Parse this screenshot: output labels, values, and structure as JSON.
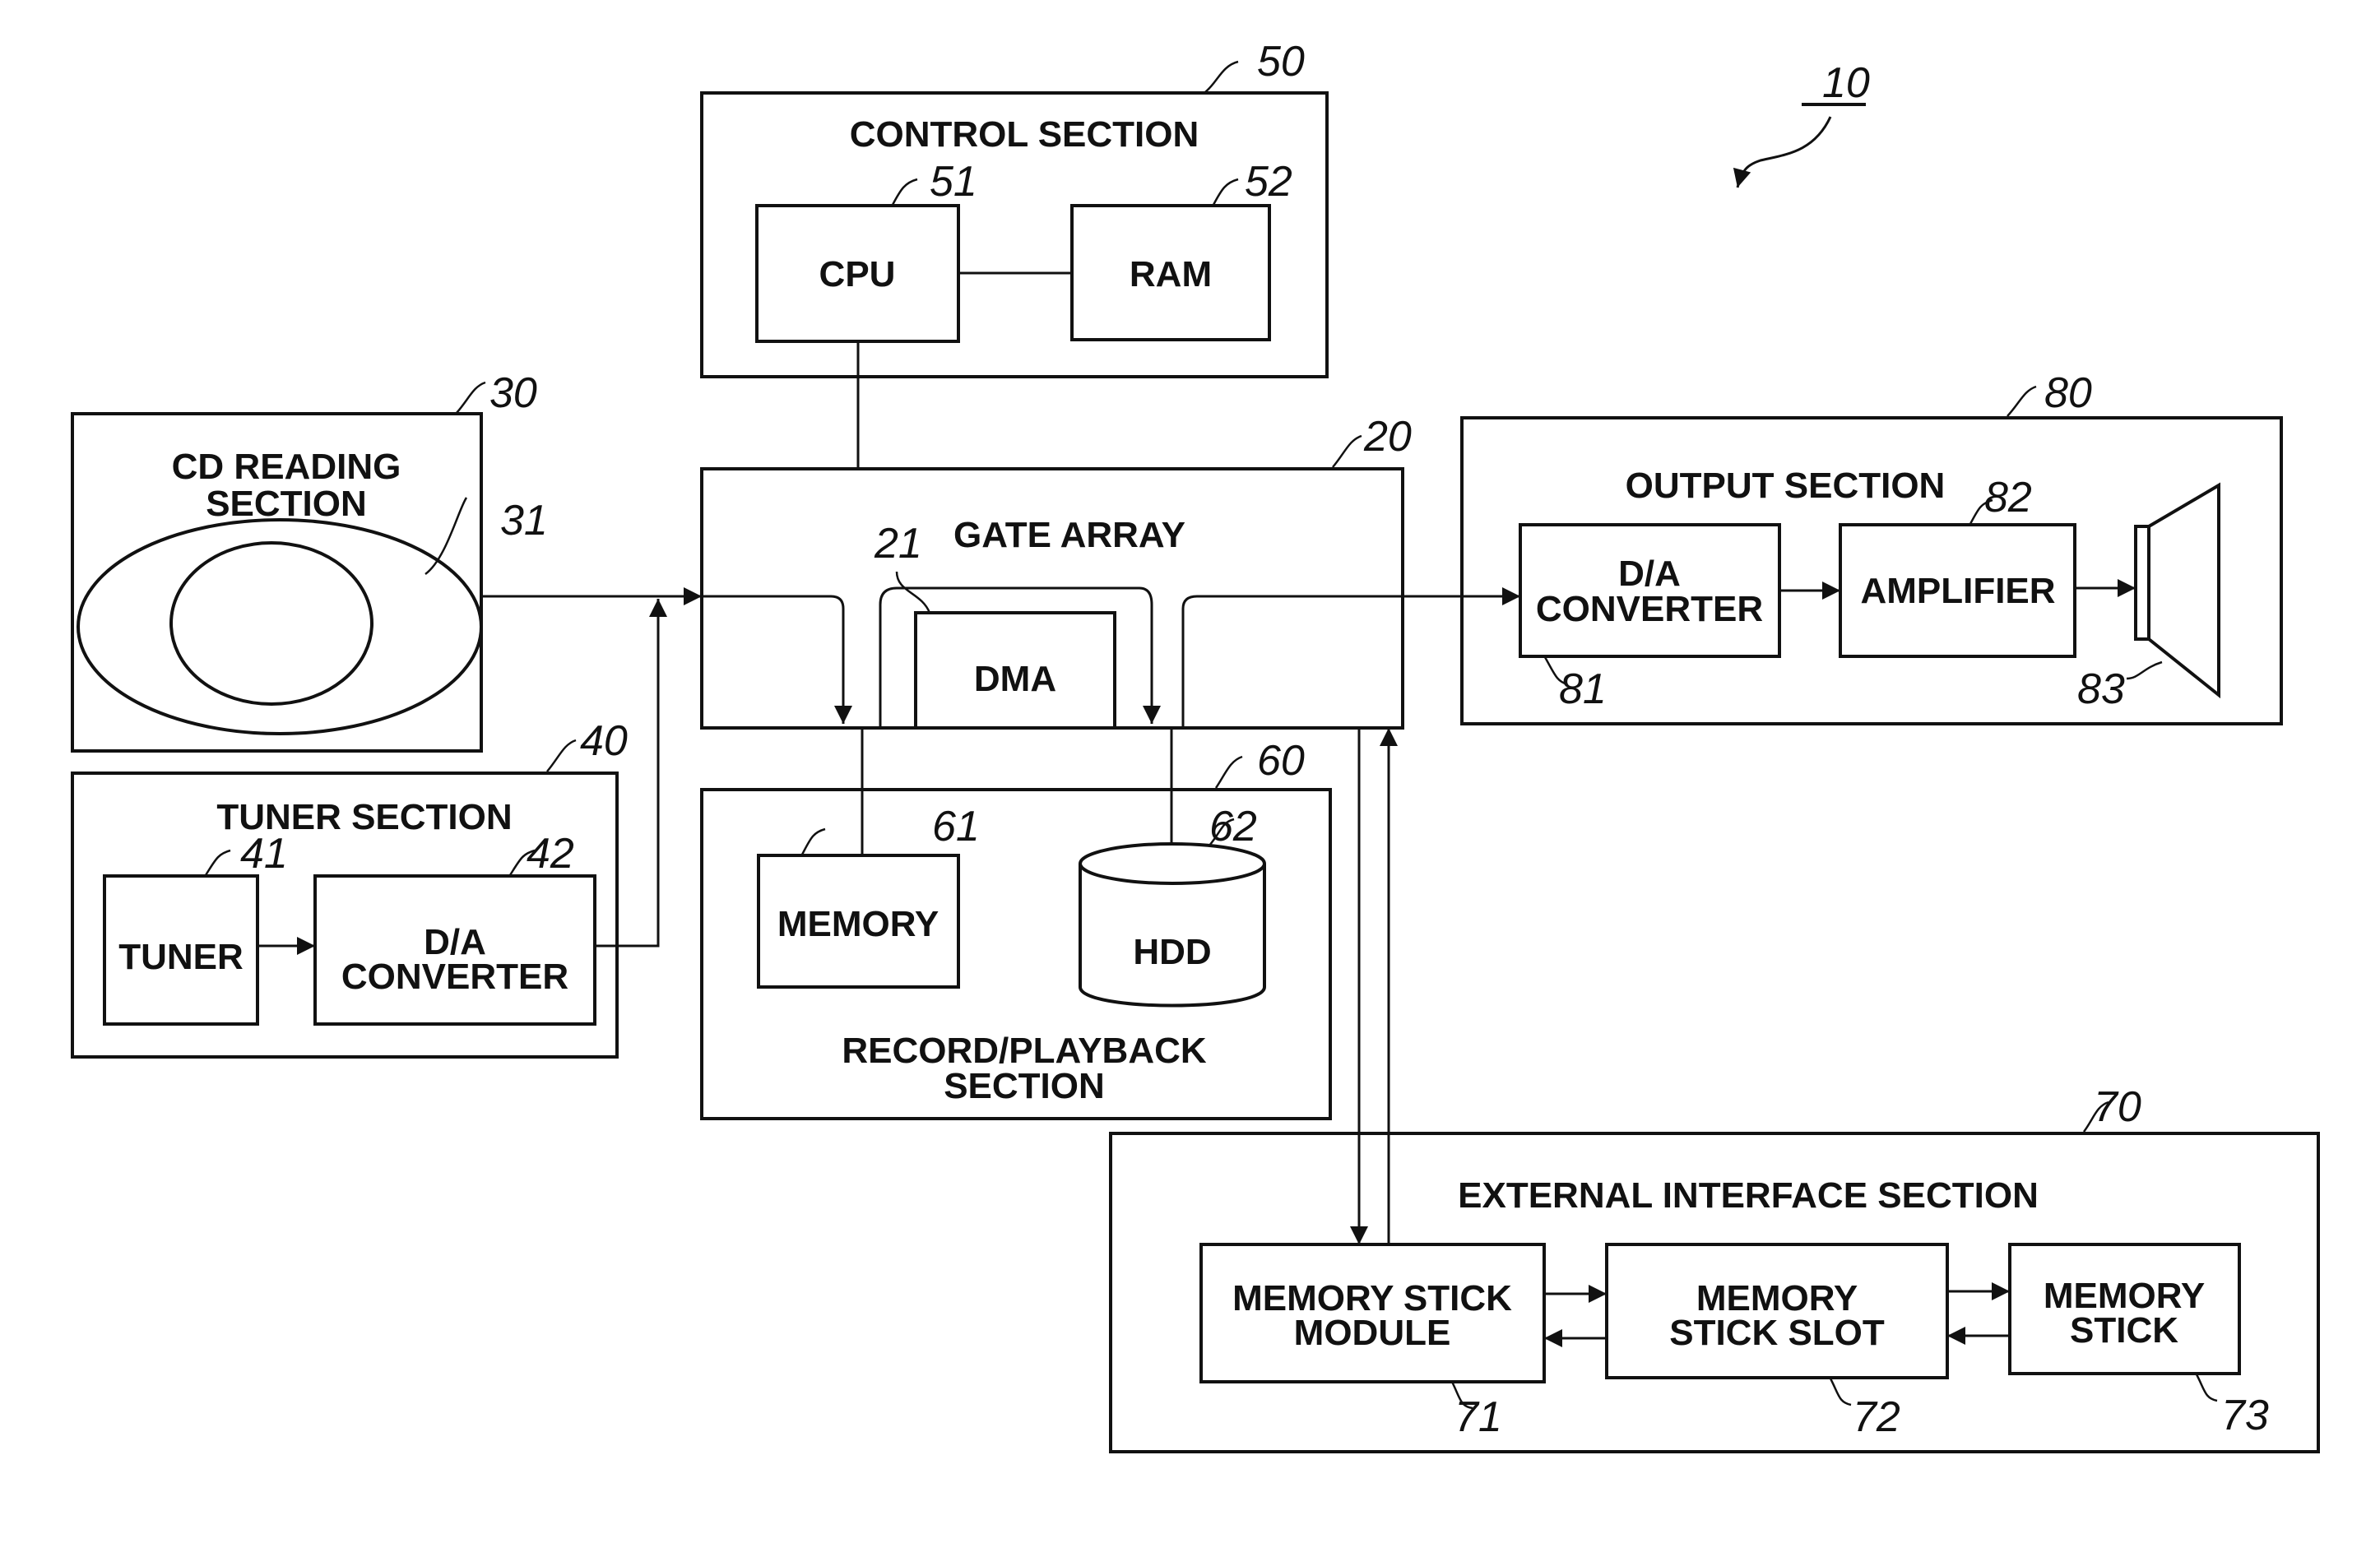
{
  "figure": {
    "ref": "10",
    "colors": {
      "line": "#111111",
      "background": "#ffffff"
    }
  },
  "blocks": {
    "control": {
      "ref": "50",
      "title": "CONTROL SECTION"
    },
    "cpu": {
      "ref": "51",
      "label": "CPU"
    },
    "ram": {
      "ref": "52",
      "label": "RAM"
    },
    "gate_array": {
      "ref": "20",
      "title": "GATE ARRAY"
    },
    "dma": {
      "ref": "21",
      "label": "DMA"
    },
    "cd_reading": {
      "ref": "30",
      "title_line1": "CD READING",
      "title_line2": "SECTION"
    },
    "disc": {
      "ref": "31"
    },
    "tuner_section": {
      "ref": "40",
      "title": "TUNER SECTION"
    },
    "tuner": {
      "ref": "41",
      "label": "TUNER"
    },
    "tuner_da": {
      "ref": "42",
      "label_line1": "D/A",
      "label_line2": "CONVERTER"
    },
    "record_playback": {
      "ref": "60",
      "title_line1": "RECORD/PLAYBACK",
      "title_line2": "SECTION"
    },
    "memory": {
      "ref": "61",
      "label": "MEMORY"
    },
    "hdd": {
      "ref": "62",
      "label": "HDD"
    },
    "output": {
      "ref": "80",
      "title": "OUTPUT SECTION"
    },
    "output_da": {
      "ref": "81",
      "label_line1": "D/A",
      "label_line2": "CONVERTER"
    },
    "amplifier": {
      "ref": "82",
      "label": "AMPLIFIER"
    },
    "speaker": {
      "ref": "83"
    },
    "external": {
      "ref": "70",
      "title": "EXTERNAL INTERFACE SECTION"
    },
    "ms_module": {
      "ref": "71",
      "label_line1": "MEMORY STICK",
      "label_line2": "MODULE"
    },
    "ms_slot": {
      "ref": "72",
      "label_line1": "MEMORY",
      "label_line2": "STICK SLOT"
    },
    "memory_stick": {
      "ref": "73",
      "label_line1": "MEMORY",
      "label_line2": "STICK"
    }
  }
}
